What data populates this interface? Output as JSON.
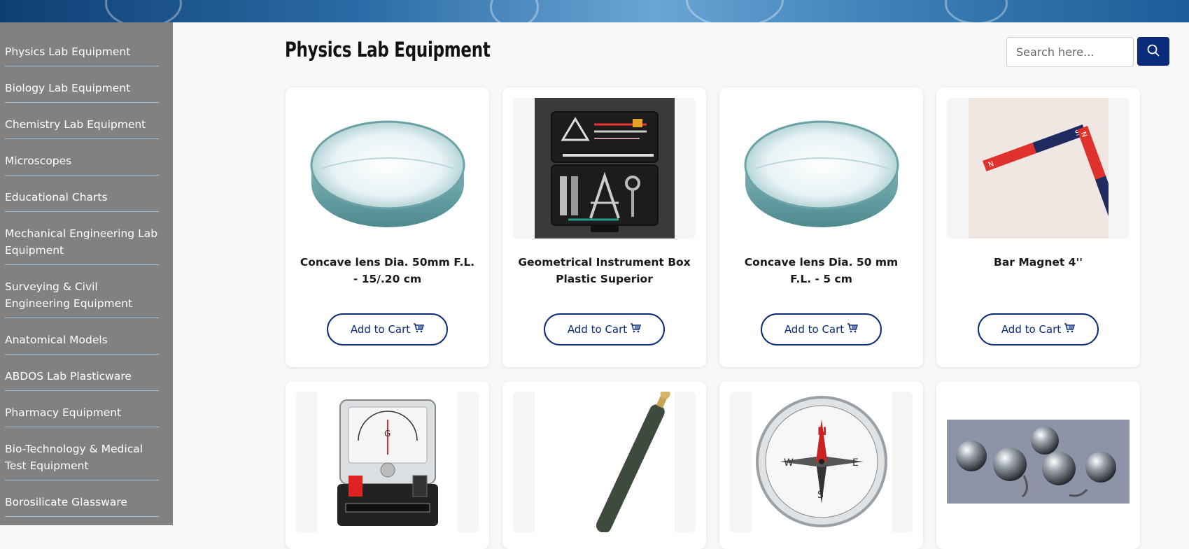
{
  "sidebar": {
    "items": [
      {
        "label": "Physics Lab Equipment"
      },
      {
        "label": "Biology Lab Equipment"
      },
      {
        "label": "Chemistry Lab Equipment"
      },
      {
        "label": "Microscopes"
      },
      {
        "label": "Educational Charts"
      },
      {
        "label": "Mechanical Engineering Lab Equipment"
      },
      {
        "label": "Surveying & Civil Engineering Equipment"
      },
      {
        "label": "Anatomical Models"
      },
      {
        "label": "ABDOS Lab Plasticware"
      },
      {
        "label": "Pharmacy Equipment"
      },
      {
        "label": "Bio-Technology & Medical Test Equipment"
      },
      {
        "label": "Borosilicate Glassware"
      }
    ]
  },
  "main": {
    "title": "Physics Lab Equipment",
    "search": {
      "placeholder": "Search here..."
    },
    "products": [
      {
        "name": "Concave lens Dia. 50mm F.L. - 15/.20 cm",
        "cart_label": "Add to Cart"
      },
      {
        "name": "Geometrical Instrument Box Plastic Superior",
        "cart_label": "Add to Cart"
      },
      {
        "name": "Concave lens Dia. 50 mm F.L. - 5 cm",
        "cart_label": "Add to Cart"
      },
      {
        "name": "Bar Magnet 4''",
        "cart_label": "Add to Cart"
      }
    ]
  },
  "icons": {
    "search": "search-icon",
    "cart": "cart-icon"
  },
  "colors": {
    "accent": "#0a2a7a",
    "sidebar_bg": "#818181",
    "divider": "#9cc2e0"
  }
}
